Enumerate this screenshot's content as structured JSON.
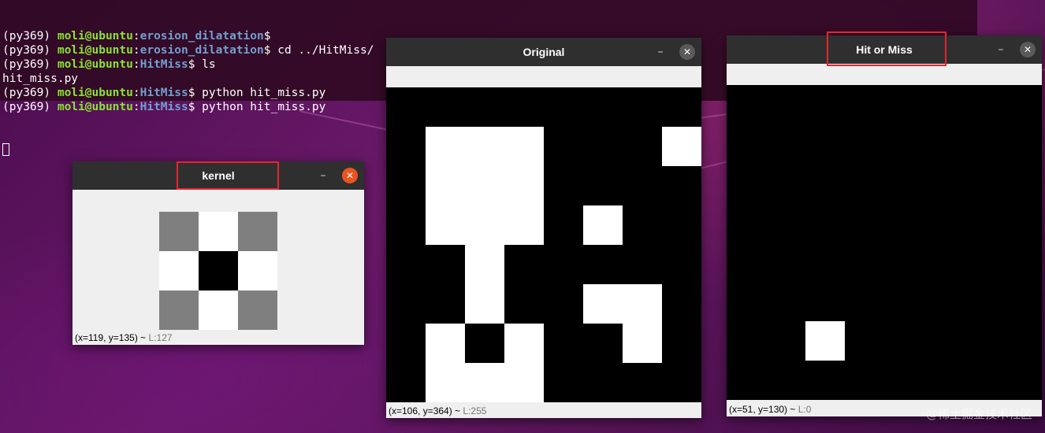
{
  "terminal": {
    "lines": [
      [
        {
          "t": "(py369) ",
          "c": ""
        },
        {
          "t": "moli@ubuntu",
          "c": "u"
        },
        {
          "t": ":",
          "c": ""
        },
        {
          "t": "erosion_dilatation",
          "c": "p"
        },
        {
          "t": "$",
          "c": ""
        }
      ],
      [
        {
          "t": "(py369) ",
          "c": ""
        },
        {
          "t": "moli@ubuntu",
          "c": "u"
        },
        {
          "t": ":",
          "c": ""
        },
        {
          "t": "erosion_dilatation",
          "c": "p"
        },
        {
          "t": "$ cd ../HitMiss/",
          "c": ""
        }
      ],
      [
        {
          "t": "(py369) ",
          "c": ""
        },
        {
          "t": "moli@ubuntu",
          "c": "u"
        },
        {
          "t": ":",
          "c": ""
        },
        {
          "t": "HitMiss",
          "c": "p"
        },
        {
          "t": "$ ls",
          "c": ""
        }
      ],
      [
        {
          "t": "hit_miss.py",
          "c": ""
        }
      ],
      [
        {
          "t": "(py369) ",
          "c": ""
        },
        {
          "t": "moli@ubuntu",
          "c": "u"
        },
        {
          "t": ":",
          "c": ""
        },
        {
          "t": "HitMiss",
          "c": "p"
        },
        {
          "t": "$ python hit_miss.py",
          "c": ""
        }
      ],
      [
        {
          "t": "(py369) ",
          "c": ""
        },
        {
          "t": "moli@ubuntu",
          "c": "u"
        },
        {
          "t": ":",
          "c": ""
        },
        {
          "t": "HitMiss",
          "c": "p"
        },
        {
          "t": "$ python hit_miss.py",
          "c": ""
        }
      ]
    ]
  },
  "kernel_window": {
    "title": "kernel",
    "min_glyph": "–",
    "close_glyph": "✕",
    "status_coords": "(x=119, y=135) ~",
    "status_level": "L:127",
    "grid": [
      [
        127,
        255,
        127
      ],
      [
        255,
        0,
        255
      ],
      [
        127,
        255,
        127
      ]
    ]
  },
  "original_window": {
    "title": "Original",
    "min_glyph": "–",
    "close_glyph": "✕",
    "status_coords": "(x=106, y=364) ~",
    "status_level": "L:255",
    "grid": [
      [
        0,
        0,
        0,
        0,
        0,
        0,
        0,
        0
      ],
      [
        0,
        1,
        1,
        1,
        0,
        0,
        0,
        1
      ],
      [
        0,
        1,
        1,
        1,
        0,
        0,
        0,
        0
      ],
      [
        0,
        1,
        1,
        1,
        0,
        1,
        0,
        0
      ],
      [
        0,
        0,
        1,
        0,
        0,
        0,
        0,
        0
      ],
      [
        0,
        0,
        1,
        0,
        0,
        1,
        1,
        0
      ],
      [
        0,
        1,
        0,
        1,
        0,
        0,
        1,
        0
      ],
      [
        0,
        1,
        1,
        1,
        0,
        0,
        0,
        0
      ]
    ]
  },
  "hitmiss_window": {
    "title": "Hit or Miss",
    "min_glyph": "–",
    "close_glyph": "✕",
    "status_coords": "(x=51, y=130) ~",
    "status_level": "L:0",
    "grid": [
      [
        0,
        0,
        0,
        0,
        0,
        0,
        0,
        0
      ],
      [
        0,
        0,
        0,
        0,
        0,
        0,
        0,
        0
      ],
      [
        0,
        0,
        0,
        0,
        0,
        0,
        0,
        0
      ],
      [
        0,
        0,
        0,
        0,
        0,
        0,
        0,
        0
      ],
      [
        0,
        0,
        0,
        0,
        0,
        0,
        0,
        0
      ],
      [
        0,
        0,
        0,
        0,
        0,
        0,
        0,
        0
      ],
      [
        0,
        0,
        1,
        0,
        0,
        0,
        0,
        0
      ],
      [
        0,
        0,
        0,
        0,
        0,
        0,
        0,
        0
      ]
    ]
  },
  "watermark": "@稀土掘金技术社区",
  "colors": {
    "highlight": "#e8232f",
    "close_active": "#e95420",
    "user": "#8ae234",
    "path": "#729fcf"
  }
}
